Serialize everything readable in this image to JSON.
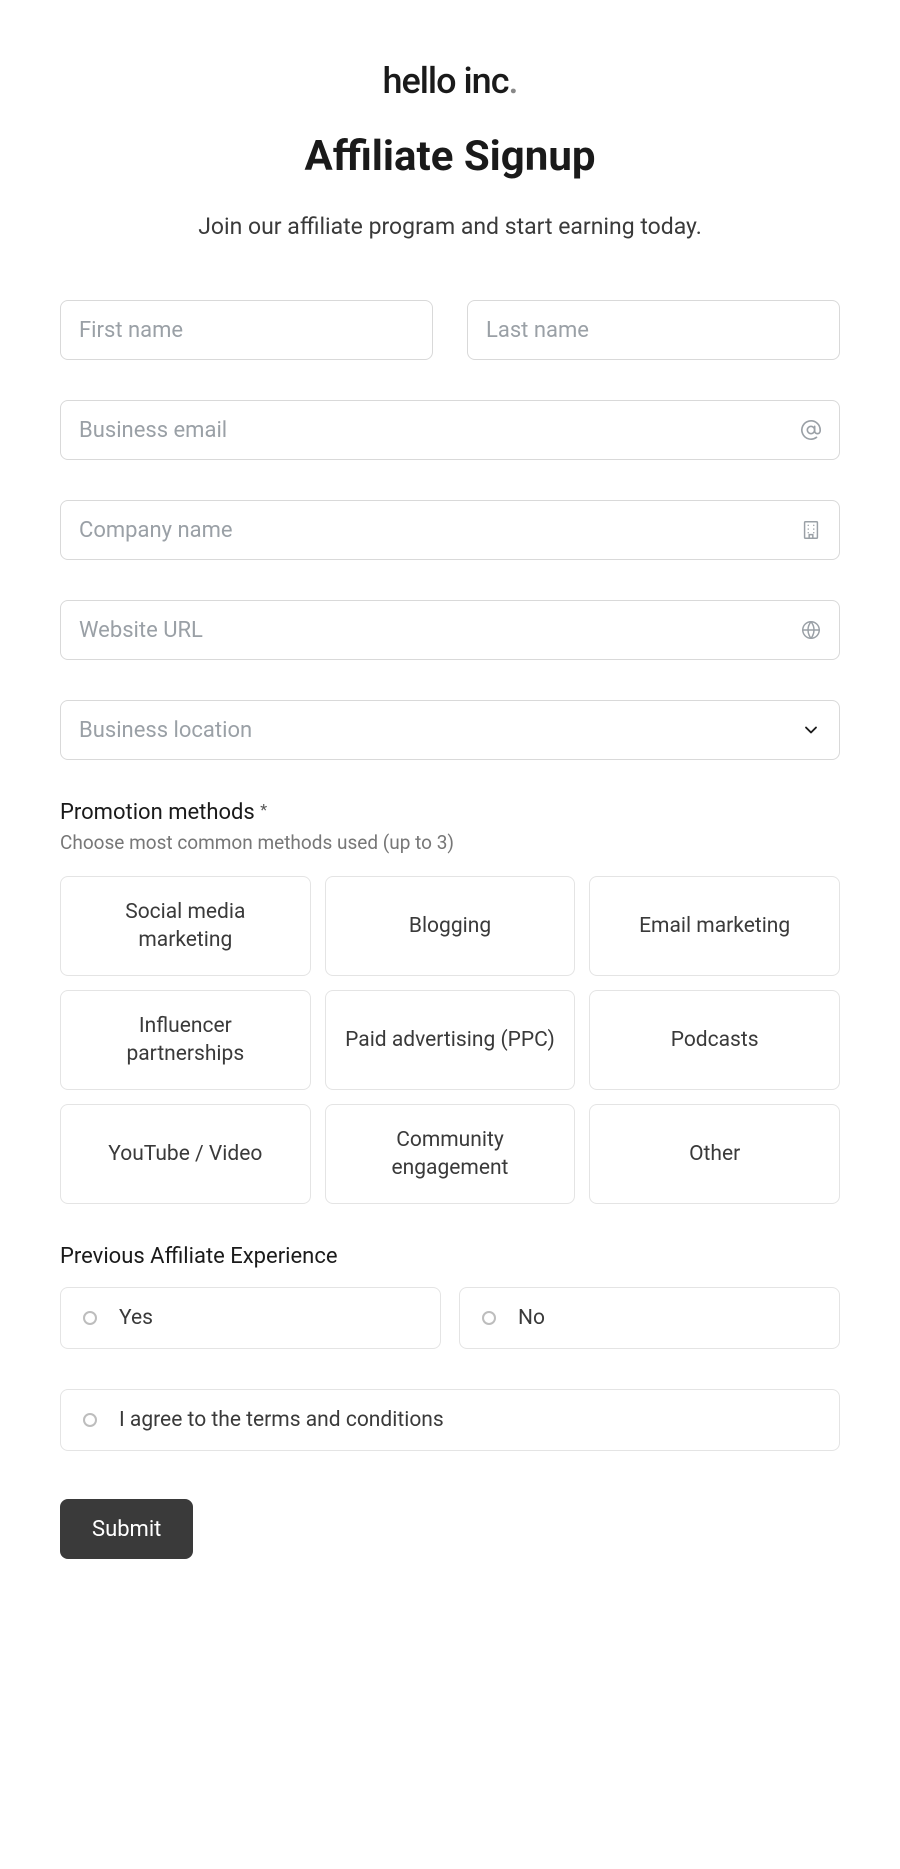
{
  "brand": {
    "name": "hello inc",
    "dot": "."
  },
  "page": {
    "title": "Affiliate Signup",
    "subtitle": "Join our affiliate program and start earning today."
  },
  "fields": {
    "first_name": {
      "placeholder": "First name"
    },
    "last_name": {
      "placeholder": "Last name"
    },
    "email": {
      "placeholder": "Business email"
    },
    "company": {
      "placeholder": "Company name"
    },
    "website": {
      "placeholder": "Website URL"
    },
    "location": {
      "placeholder": "Business location"
    }
  },
  "promotion": {
    "label": "Promotion methods",
    "required_mark": "*",
    "help": "Choose most common methods used (up to 3)",
    "options": [
      "Social media marketing",
      "Blogging",
      "Email marketing",
      "Influencer partnerships",
      "Paid advertising (PPC)",
      "Podcasts",
      "YouTube / Video",
      "Community engagement",
      "Other"
    ]
  },
  "experience": {
    "label": "Previous Affiliate Experience",
    "options": [
      "Yes",
      "No"
    ]
  },
  "terms": {
    "label": "I agree to the terms and conditions"
  },
  "submit": {
    "label": "Submit"
  }
}
